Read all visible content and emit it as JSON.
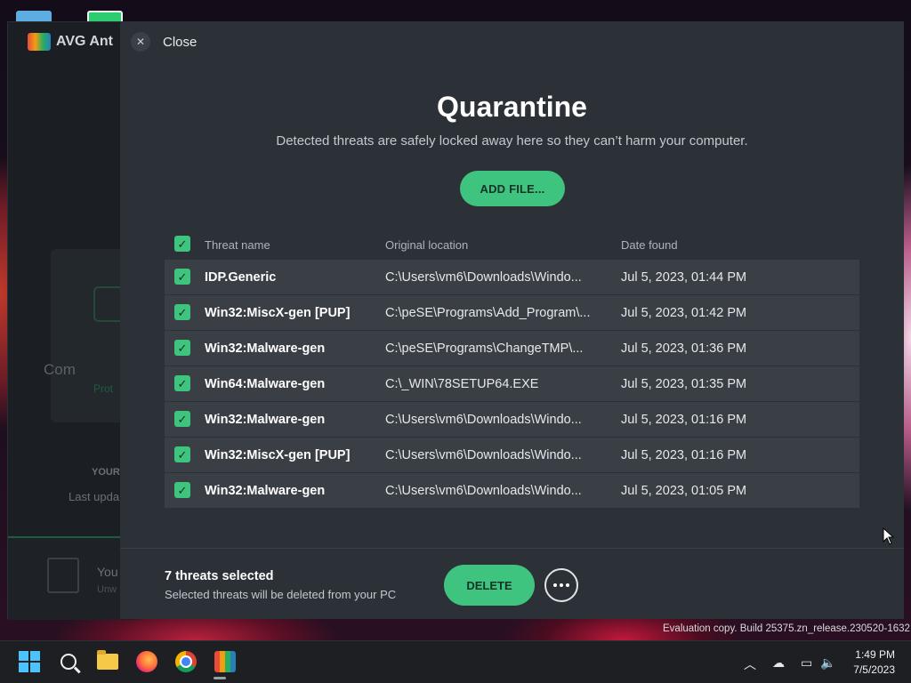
{
  "desktop": {
    "watermark": "Evaluation copy. Build 25375.zn_release.230520-1632"
  },
  "avg_main": {
    "app_title": "AVG Ant",
    "status_title": "Com",
    "status_sub": "Prot",
    "update_heading": "YOUR",
    "update_text": "Last upda",
    "promo_title": "You",
    "promo_sub": "Unw"
  },
  "dialog": {
    "close_label": "Close",
    "title": "Quarantine",
    "subtitle": "Detected threats are safely locked away here so they can’t harm your computer.",
    "add_file_label": "ADD FILE...",
    "table": {
      "headers": {
        "name": "Threat name",
        "location": "Original location",
        "date": "Date found"
      },
      "rows": [
        {
          "name": "IDP.Generic",
          "location": "C:\\Users\\vm6\\Downloads\\Windo...",
          "date": "Jul 5, 2023, 01:44 PM",
          "checked": true
        },
        {
          "name": "Win32:MiscX-gen [PUP]",
          "location": "C:\\peSE\\Programs\\Add_Program\\...",
          "date": "Jul 5, 2023, 01:42 PM",
          "checked": true
        },
        {
          "name": "Win32:Malware-gen",
          "location": "C:\\peSE\\Programs\\ChangeTMP\\...",
          "date": "Jul 5, 2023, 01:36 PM",
          "checked": true
        },
        {
          "name": "Win64:Malware-gen",
          "location": "C:\\_WIN\\78SETUP64.EXE",
          "date": "Jul 5, 2023, 01:35 PM",
          "checked": true
        },
        {
          "name": "Win32:Malware-gen",
          "location": "C:\\Users\\vm6\\Downloads\\Windo...",
          "date": "Jul 5, 2023, 01:16 PM",
          "checked": true
        },
        {
          "name": "Win32:MiscX-gen [PUP]",
          "location": "C:\\Users\\vm6\\Downloads\\Windo...",
          "date": "Jul 5, 2023, 01:16 PM",
          "checked": true
        },
        {
          "name": "Win32:Malware-gen",
          "location": "C:\\Users\\vm6\\Downloads\\Windo...",
          "date": "Jul 5, 2023, 01:05 PM",
          "checked": true
        }
      ]
    },
    "footer": {
      "selected_count": "7 threats selected",
      "selected_note": "Selected threats will be deleted from your PC",
      "delete_label": "DELETE"
    }
  },
  "taskbar": {
    "apps": [
      "start-icon",
      "search-icon",
      "file-explorer-icon",
      "firefox-icon",
      "chrome-icon",
      "avg-icon"
    ],
    "tray": [
      "chevron-up-icon",
      "network-offline-icon",
      "display-icon",
      "volume-icon"
    ],
    "time": "1:49 PM",
    "date": "7/5/2023"
  },
  "colors": {
    "accent": "#3fc480",
    "dialog_bg": "#2c3137",
    "row_bg": "#3a3f46"
  }
}
